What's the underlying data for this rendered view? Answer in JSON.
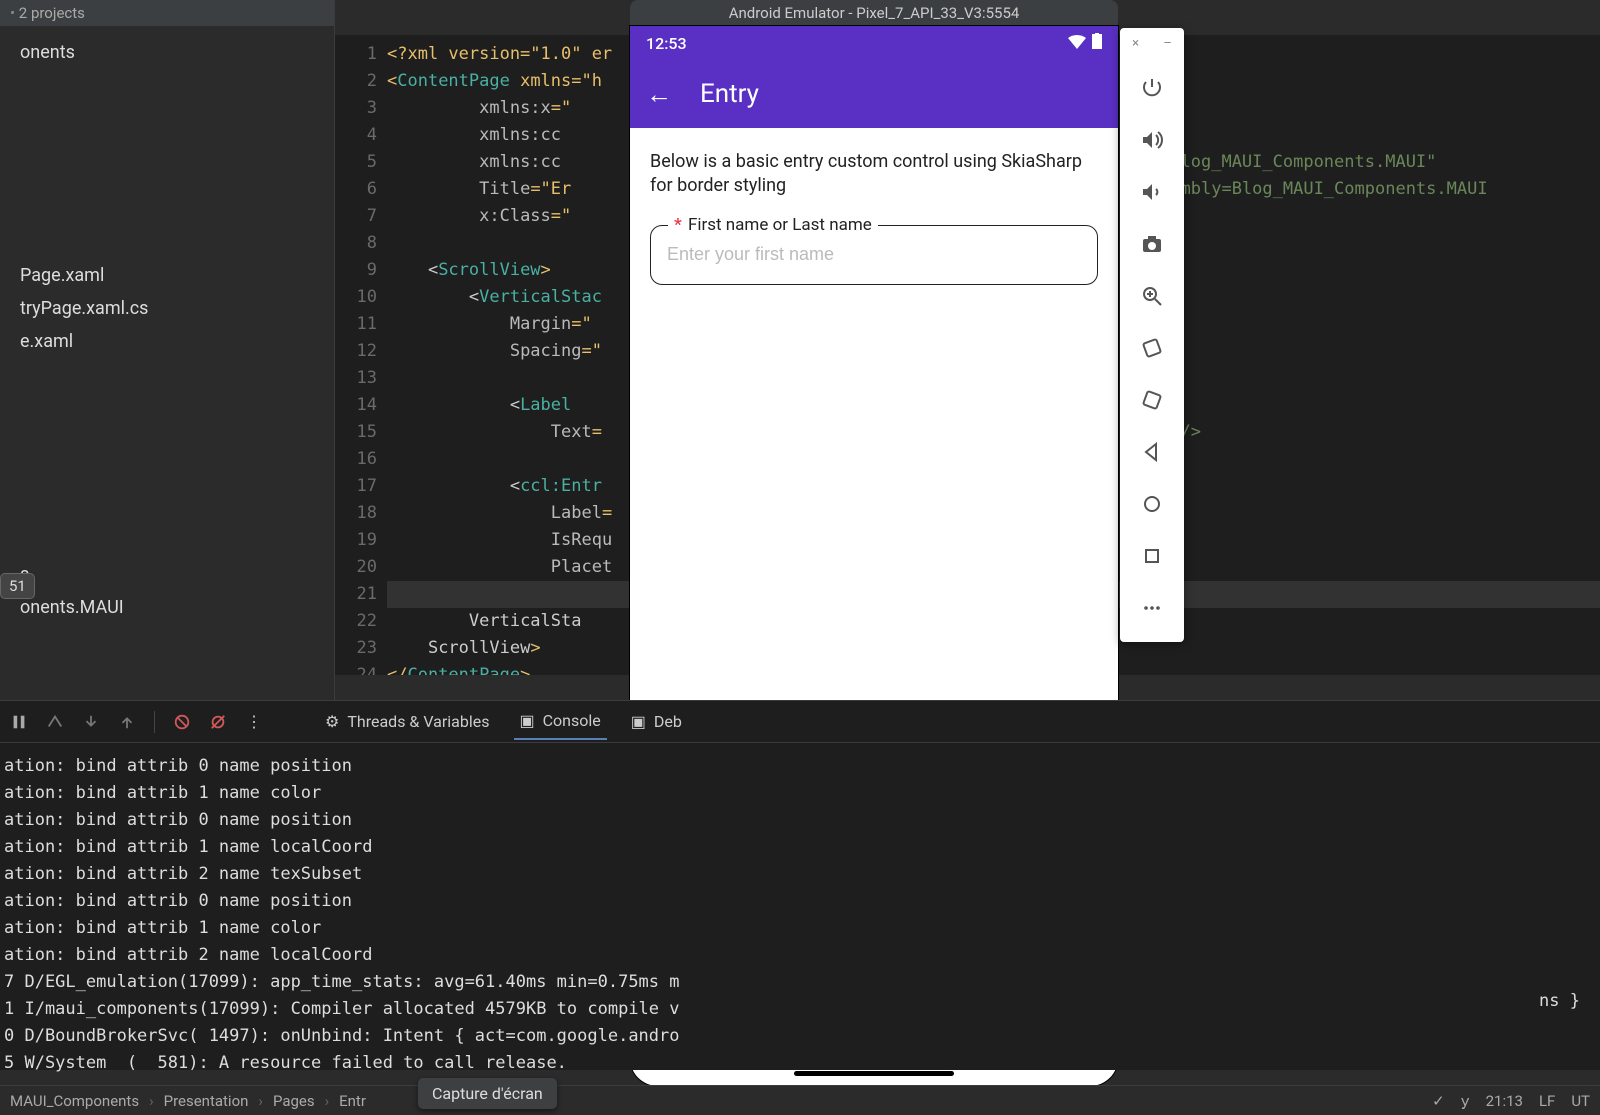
{
  "project_header": {
    "text": "2 projects"
  },
  "tree": {
    "items": [
      "onents",
      "Page.xaml",
      "tryPage.xaml.cs",
      "e.xaml",
      "s",
      "onents.MAUI"
    ]
  },
  "run_bubble": "51",
  "editor": {
    "line_numbers": [
      "1",
      "2",
      "3",
      "4",
      "5",
      "6",
      "7",
      "8",
      "9",
      "10",
      "11",
      "12",
      "13",
      "14",
      "15",
      "16",
      "17",
      "18",
      "19",
      "20",
      "21",
      "22",
      "23",
      "24"
    ],
    "highlighted_line": 21,
    "lines": [
      {
        "pre": "<?xml version=\"1.0\" er"
      },
      {
        "pre": "<",
        "e": "ContentPage",
        "post": " xmlns=\"h"
      },
      {
        "idt": "         ",
        "a": "xmlns:x",
        "post": "=\""
      },
      {
        "idt": "         ",
        "a": "xmlns:cc",
        "post": ""
      },
      {
        "idt": "         ",
        "a": "xmlns:cc",
        "post": "",
        "far": "bels;assembly=Blog_MAUI_Components.MAUI\""
      },
      {
        "idt": "         ",
        "a": "Title",
        "post": "=\"Er",
        "far": "sic.Labels;assembly=Blog_MAUI_Components.MAUI"
      },
      {
        "idt": "         ",
        "a": "x:Class",
        "post": "=\""
      },
      {
        "pre": ""
      },
      {
        "idt": "    <",
        "e": "ScrollView",
        "post": ">"
      },
      {
        "idt": "        <",
        "e": "VerticalStac",
        "post": ""
      },
      {
        "idt": "            ",
        "a": "Margin",
        "post": "=\""
      },
      {
        "idt": "            ",
        "a": "Spacing",
        "post": "=\""
      },
      {
        "pre": ""
      },
      {
        "idt": "            <",
        "e": "Label",
        "post": ""
      },
      {
        "idt": "                ",
        "a": "Text",
        "post": "=",
        "far": "order styling\" />"
      },
      {
        "pre": ""
      },
      {
        "idt": "            <",
        "e": "ccl:Entr",
        "post": ""
      },
      {
        "idt": "                ",
        "a": "Label",
        "post": "="
      },
      {
        "idt": "                ",
        "a": "IsRequ",
        "post": ""
      },
      {
        "idt": "                ",
        "a": "Placet",
        "post": ""
      },
      {
        "pre": ""
      },
      {
        "idt": "        </",
        "e": "VerticalSta",
        "post": ""
      },
      {
        "idt": "    </",
        "e": "ScrollView",
        "post": ">"
      },
      {
        "pre": "</",
        "e": "ContentPage",
        "post": ">"
      }
    ]
  },
  "emulator": {
    "title": "Android Emulator - Pixel_7_API_33_V3:5554",
    "clock": "12:53",
    "app_title": "Entry",
    "description": "Below is a basic entry custom control using SkiaSharp for border styling",
    "entry": {
      "required_mark": "*",
      "label": "First name or Last name",
      "placeholder": "Enter your first name"
    },
    "toolbar_top": {
      "close": "×",
      "min": "–"
    }
  },
  "debug": {
    "tabs": {
      "threads": "Threads & Variables",
      "console": "Console",
      "debug": "Deb"
    },
    "rows": [
      "ation: bind attrib 0 name position",
      "ation: bind attrib 1 name color",
      "ation: bind attrib 0 name position",
      "ation: bind attrib 1 name localCoord",
      "ation: bind attrib 2 name texSubset",
      "ation: bind attrib 0 name position",
      "ation: bind attrib 1 name color",
      "ation: bind attrib 2 name localCoord",
      "7 D/EGL_emulation(17099): app_time_stats: avg=61.40ms min=0.75ms m",
      "1 I/maui_components(17099): Compiler allocated 4579KB to compile v",
      "0 D/BoundBrokerSvc( 1497): onUnbind: Intent { act=com.google.andro",
      "5 W/System  (  581): A resource failed to call release."
    ],
    "right_frag": "ns }"
  },
  "breadcrumb": {
    "parts": [
      "MAUI_Components",
      "Presentation",
      "Pages",
      "Entr"
    ]
  },
  "tooltip": "Capture d'écran",
  "status_right": {
    "time": "21:13",
    "lf": "LF",
    "ut": "UT"
  }
}
